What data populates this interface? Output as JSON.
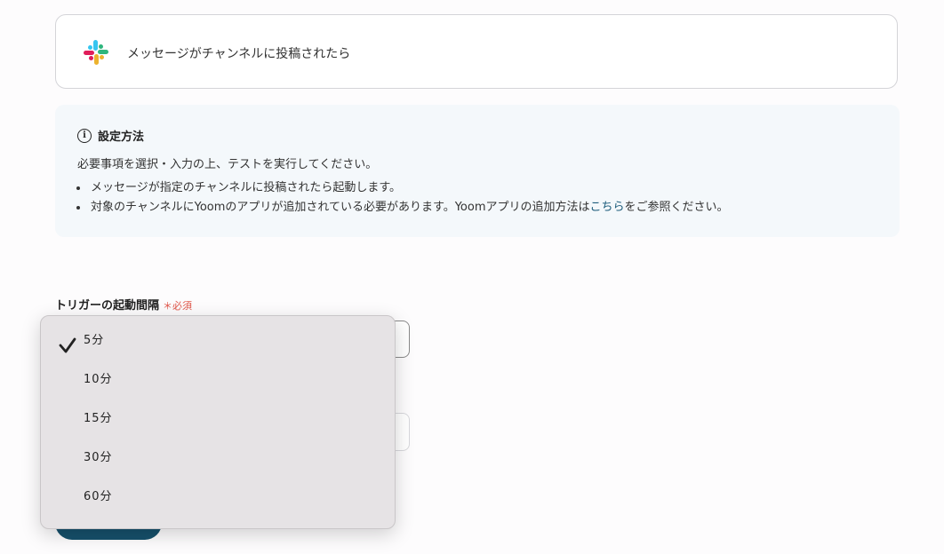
{
  "trigger": {
    "label": "メッセージがチャンネルに投稿されたら",
    "app_icon": "slack-logo"
  },
  "info": {
    "title": "設定方法",
    "description": "必要事項を選択・入力の上、テストを実行してください。",
    "bullet1": "メッセージが指定のチャンネルに投稿されたら起動します。",
    "bullet2_prefix": "対象のチャンネルにYoomのアプリが追加されている必要があります。Yoomアプリの追加方法は",
    "bullet2_link": "こちら",
    "bullet2_suffix": "をご参照ください。"
  },
  "interval_field": {
    "label": "トリガーの起動間隔",
    "required_label": "＊必須",
    "selected_value": "5分"
  },
  "dropdown": {
    "options": [
      {
        "label": "5分",
        "selected": true
      },
      {
        "label": "10分",
        "selected": false
      },
      {
        "label": "15分",
        "selected": false
      },
      {
        "label": "30分",
        "selected": false
      },
      {
        "label": "60分",
        "selected": false
      }
    ]
  },
  "colors": {
    "accent": "#16506b",
    "required": "#e0564a",
    "link": "#1a5a7a",
    "info_bg": "#f4f8fb"
  }
}
